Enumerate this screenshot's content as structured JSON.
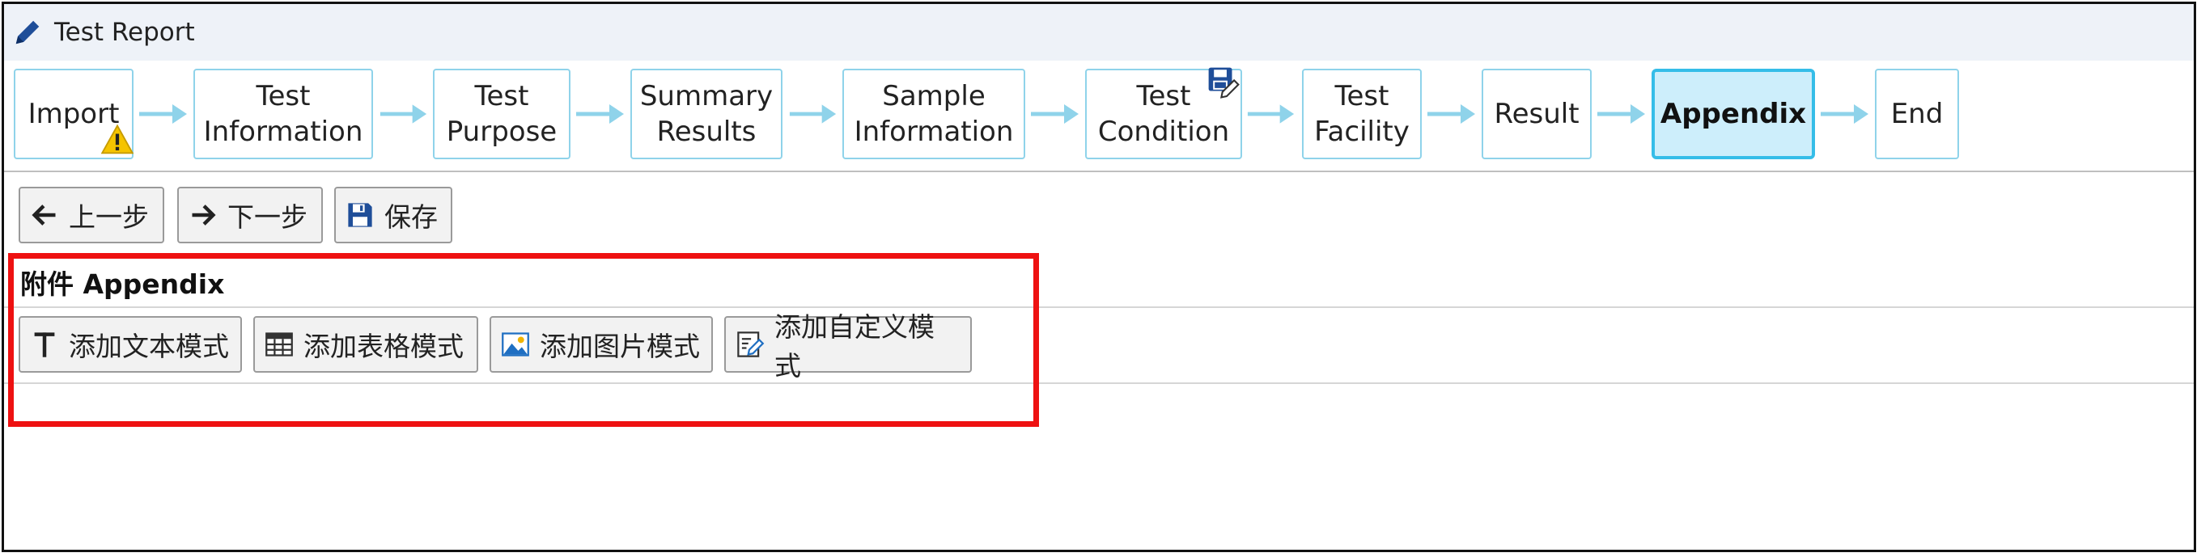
{
  "window": {
    "title": "Test Report"
  },
  "steps": [
    {
      "label": "Import",
      "state": "warning"
    },
    {
      "label": "Test\nInformation"
    },
    {
      "label": "Test\nPurpose"
    },
    {
      "label": "Summary\nResults"
    },
    {
      "label": "Sample\nInformation"
    },
    {
      "label": "Test\nCondition",
      "state": "saved"
    },
    {
      "label": "Test\nFacility"
    },
    {
      "label": "Result"
    },
    {
      "label": "Appendix",
      "state": "active"
    },
    {
      "label": "End"
    }
  ],
  "toolbar": {
    "prev_label": "上一步",
    "next_label": "下一步",
    "save_label": "保存"
  },
  "appendix": {
    "title": "附件 Appendix",
    "buttons": {
      "text_mode": "添加文本模式",
      "table_mode": "添加表格模式",
      "image_mode": "添加图片模式",
      "custom_mode": "添加自定义模式"
    }
  },
  "colors": {
    "step_border": "#8fd3ea",
    "step_active_bg": "#cdeefb",
    "step_active_border": "#35bde8",
    "arrow": "#8fd3ea",
    "highlight": "#ee1111",
    "warning": "#f5c400",
    "save_icon": "#1f4e99"
  },
  "icons": {
    "title": "pencil-icon",
    "import_state": "warning-icon",
    "condition_state": "save-edit-icon",
    "prev": "arrow-left-icon",
    "next": "arrow-right-icon",
    "save": "floppy-disk-icon",
    "text_mode": "text-t-icon",
    "table_mode": "table-grid-icon",
    "image_mode": "image-icon",
    "custom_mode": "edit-document-icon"
  }
}
